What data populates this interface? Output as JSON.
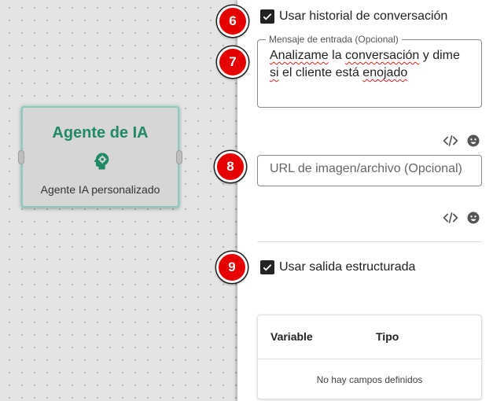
{
  "node": {
    "title": "Agente de IA",
    "subtitle": "Agente IA personalizado",
    "icon": "head-gear-icon",
    "accent": "#1f8a64"
  },
  "badges": [
    "6",
    "7",
    "8",
    "9"
  ],
  "settings": {
    "history_label": "Usar historial de conversación",
    "history_checked": true,
    "input_message": {
      "legend": "Mensaje de entrada (Opcional)",
      "words": [
        "Analizame",
        " la ",
        "conversación",
        " y dime ",
        "si",
        " el cliente está ",
        "enojado"
      ]
    },
    "url_placeholder": "URL de imagen/archivo (Opcional)",
    "structured_label": "Usar salida estructurada",
    "structured_checked": true
  },
  "table": {
    "columns": [
      "Variable",
      "Tipo"
    ],
    "empty_text": "No hay campos definidos"
  },
  "colors": {
    "badge": "#e60000"
  }
}
